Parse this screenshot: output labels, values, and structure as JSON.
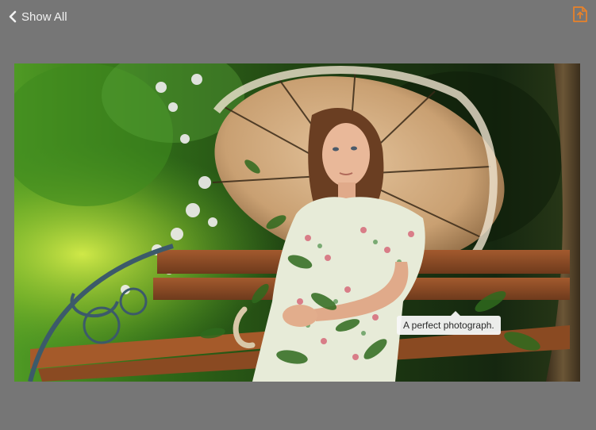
{
  "toolbar": {
    "back_label": "Show All",
    "back_icon": "chevron-left-icon",
    "share_icon": "share-icon"
  },
  "photo": {
    "caption": "A perfect photograph."
  },
  "colors": {
    "background": "#767676",
    "accent": "#e8822a",
    "text": "#f2f2f2"
  }
}
